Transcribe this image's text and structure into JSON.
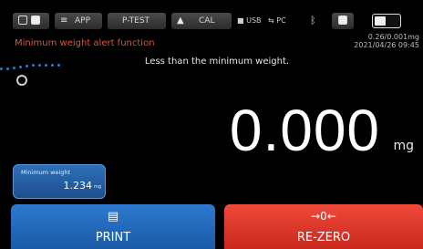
{
  "topbar": {
    "app_label": "APP",
    "ptest_label": "P-TEST",
    "cal_label": "CAL",
    "usb_label": "USB",
    "pc_label": "PC"
  },
  "alert": {
    "title": "Minimum weight alert function",
    "message": "Less than the minimum weight."
  },
  "info": {
    "resolution": "0.26/0.001mg",
    "datetime": "2021/04/26 09:45"
  },
  "reading": {
    "value": "0.000",
    "unit": "mg"
  },
  "min_weight": {
    "label": "Minimum weight",
    "value": "1.234",
    "unit": "mg"
  },
  "buttons": {
    "print": "PRINT",
    "rezero": "RE-ZERO",
    "rezero_symbol": "→0←"
  },
  "colors": {
    "alert": "#e0503c",
    "print_button": "#1f64b4",
    "rezero_button": "#e03a2c",
    "min_weight_box": "#26609f"
  }
}
